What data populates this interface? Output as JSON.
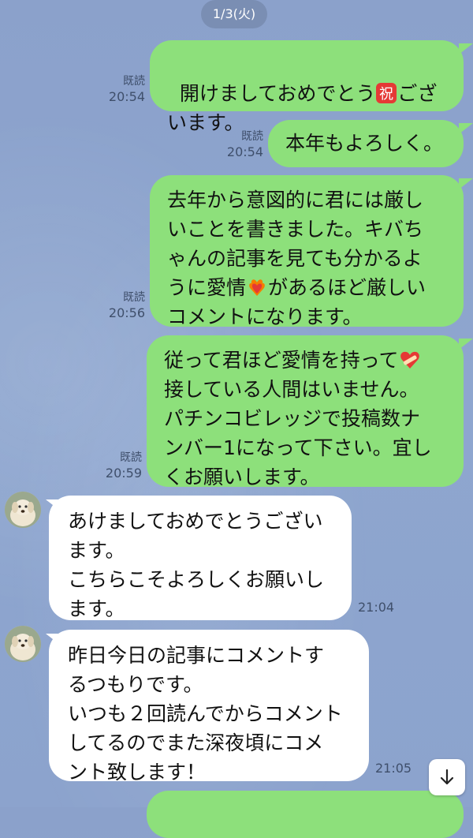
{
  "date_label": "1/3(火)",
  "messages": [
    {
      "lines": [
        "開けましておめでとう",
        "ござ",
        "います。"
      ],
      "read": "既読",
      "time": "20:54",
      "emoji": "祝"
    },
    {
      "text": "本年もよろしく。",
      "read": "既読",
      "time": "20:54"
    },
    {
      "lines_a": "去年から意図的に君には厳し\nいことを書きました。キバち\nゃんの記事を見ても分かるよ\nうに愛情",
      "lines_b": "があるほど厳しい\nコメントになります。",
      "read": "既読",
      "time": "20:56"
    },
    {
      "lines_a": "従って君ほど愛情を持って",
      "lines_b": "\n接している人間はいません。\nパチンコビレッジで投稿数ナ\nンバー1になって下さい。宜し\nくお願いします。",
      "read": "既読",
      "time": "20:59"
    },
    {
      "text": "あけましておめでとうござい\nます。\nこちらこそよろしくお願いし\nます。",
      "time": "21:04"
    },
    {
      "text": "昨日今日の記事にコメントす\nるつもりです。\nいつも２回読んでからコメント\nしてるのでまた深夜頃にコメ\nント致します！",
      "time": "21:05"
    }
  ],
  "icons": {
    "stamp": "congratulations-emoji",
    "heart_fire": "heart-on-fire-emoji",
    "mending_heart": "mending-heart-emoji",
    "scroll": "arrow-down-icon",
    "avatar": "dog-avatar"
  },
  "colors": {
    "outgoing": "#8de07b",
    "incoming": "#ffffff",
    "background": "#8aa2cc"
  }
}
